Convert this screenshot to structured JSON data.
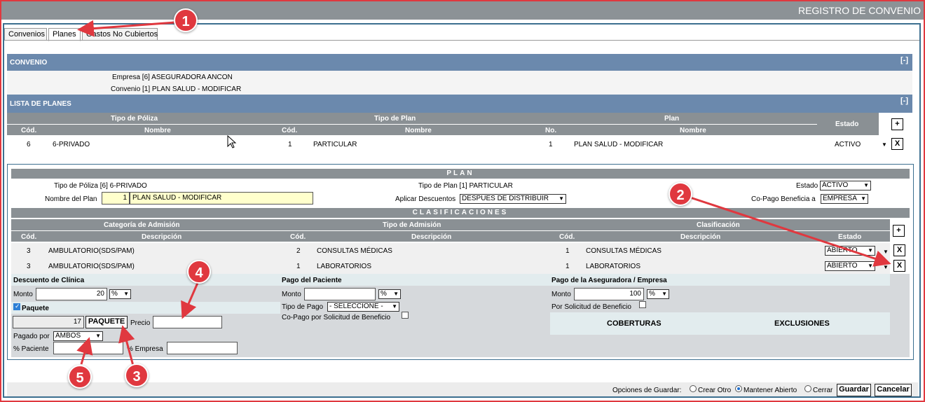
{
  "window": {
    "title": "REGISTRO DE CONVENIO"
  },
  "tabs": [
    "Convenios",
    "Planes",
    "Gastos No Cubiertos"
  ],
  "convenio": {
    "header": "CONVENIO",
    "collapse": "[-]",
    "empresa": "Empresa [6] ASEGURADORA ANCON",
    "convenio": "Convenio [1] PLAN SALUD - MODIFICAR"
  },
  "lista_planes": {
    "header": "LISTA DE PLANES",
    "collapse": "[-]",
    "group_headers": [
      "Tipo de Póliza",
      "Tipo de Plan",
      "Plan",
      "Estado"
    ],
    "sub_headers": [
      "Cód.",
      "Nombre",
      "Cód.",
      "Nombre",
      "No.",
      "Nombre"
    ],
    "add": "+",
    "row": {
      "tp_cod": "6",
      "tp_nombre": "6-PRIVADO",
      "plan_cod": "1",
      "plan_nombre": "PARTICULAR",
      "no": "1",
      "nombre": "PLAN SALUD - MODIFICAR",
      "estado": "ACTIVO",
      "caret": "▼",
      "remove": "X"
    }
  },
  "plan": {
    "header": "PLAN",
    "tipo_poliza": "Tipo de Póliza [6] 6-PRIVADO",
    "tipo_plan": "Tipo de Plan [1] PARTICULAR",
    "estado_label": "Estado",
    "estado_value": "ACTIVO",
    "nombre_label": "Nombre del Plan",
    "nombre_num": "1",
    "nombre_value": "PLAN SALUD - MODIFICAR",
    "aplicar_label": "Aplicar Descuentos",
    "aplicar_value": "DESPUES DE DISTRIBUIR",
    "copago_label": "Co-Pago Beneficia a",
    "copago_value": "EMPRESA"
  },
  "clasificaciones": {
    "header": "CLASIFICACIONES",
    "group_headers": [
      "Categoría de Admisión",
      "Tipo de Admisión",
      "Clasificación",
      "Estado"
    ],
    "sub_headers": [
      "Cód.",
      "Descripción",
      "Cód.",
      "Descripción",
      "Cód.",
      "Descripción"
    ],
    "add": "+",
    "rows": [
      {
        "c1": "3",
        "d1": "AMBULATORIO(SDS/PAM)",
        "c2": "2",
        "d2": "CONSULTAS MÉDICAS",
        "c3": "1",
        "d3": "CONSULTAS MÉDICAS",
        "estado": "ABIERTO",
        "caret": "▼",
        "remove": "X"
      },
      {
        "c1": "3",
        "d1": "AMBULATORIO(SDS/PAM)",
        "c2": "1",
        "d2": "LABORATORIOS",
        "c3": "1",
        "d3": "LABORATORIOS",
        "estado": "ABIERTO",
        "caret": "▼",
        "remove": "X"
      }
    ]
  },
  "descuento": {
    "header": "Descuento de Clínica",
    "monto_label": "Monto",
    "monto_value": "20",
    "pct": "%",
    "paquete_label": "Paquete",
    "paquete_num": "17",
    "paquete_button": "PAQUETE",
    "precio_label": "Precio",
    "pagado_label": "Pagado por",
    "pagado_value": "AMBOS",
    "pct_paciente_label": "% Paciente",
    "pct_empresa_label": "% Empresa"
  },
  "pago_paciente": {
    "header": "Pago del Paciente",
    "monto_label": "Monto",
    "pct": "%",
    "tipo_label": "Tipo de Pago",
    "tipo_value": "- SELECCIONE -",
    "copago_label": "Co-Pago por Solicitud de Beneficio"
  },
  "pago_aseguradora": {
    "header": "Pago de la Aseguradora / Empresa",
    "monto_label": "Monto",
    "monto_value": "100",
    "pct": "%",
    "solicitud_label": "Por Solicitud de Beneficio",
    "coberturas": "COBERTURAS",
    "exclusiones": "EXCLUSIONES"
  },
  "footer": {
    "opciones_label": "Opciones de Guardar:",
    "crear": "Crear Otro",
    "mantener": "Mantener Abierto",
    "cerrar": "Cerrar",
    "guardar": "Guardar",
    "cancelar": "Cancelar"
  },
  "annotations": [
    "1",
    "2",
    "3",
    "4",
    "5"
  ],
  "colors": {
    "annotation": "#e0383f",
    "section": "#6b89ad",
    "header": "#8a9094"
  }
}
